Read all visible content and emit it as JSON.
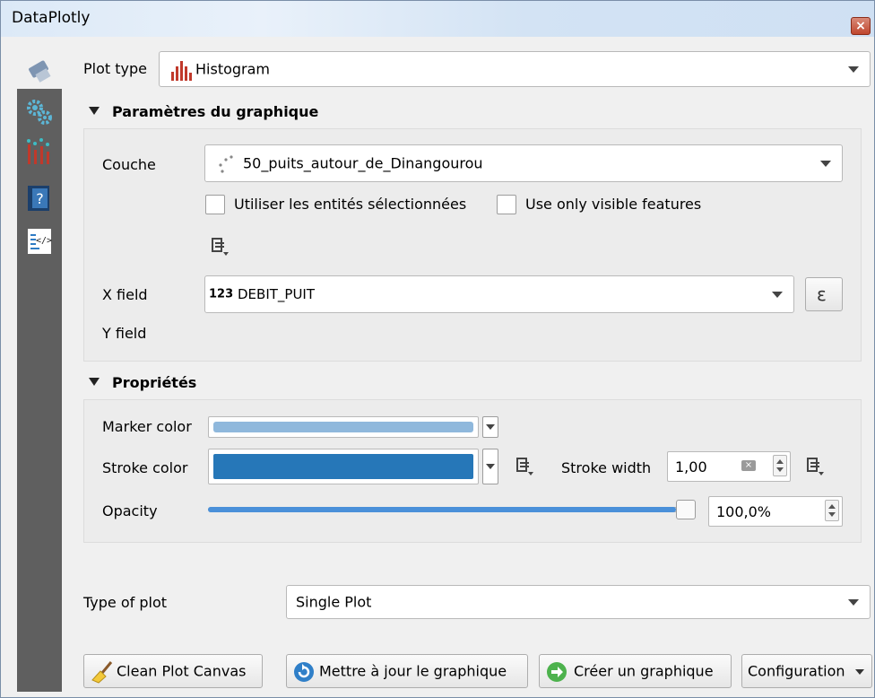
{
  "window": {
    "title": "DataPlotly",
    "close_glyph": "×"
  },
  "sidebar": {
    "icons": [
      "brush-icon",
      "settings-gears-icon",
      "plot-chart-icon",
      "help-icon",
      "code-icon"
    ]
  },
  "plot_type": {
    "label": "Plot type",
    "value": "Histogram"
  },
  "graph_params": {
    "title": "Paramètres du graphique",
    "layer_label": "Couche",
    "layer_value": "50_puits_autour_de_Dinangourou",
    "use_selected_label": "Utiliser les entités sélectionnées",
    "use_visible_label": "Use only visible features",
    "x_field_label": "X field",
    "x_field_type_badge": "123",
    "x_field_value": "DEBIT_PUIT",
    "expression_glyph": "ε",
    "y_field_label": "Y field"
  },
  "properties": {
    "title": "Propriétés",
    "marker_color_label": "Marker color",
    "stroke_color_label": "Stroke color",
    "stroke_width_label": "Stroke width",
    "stroke_width_value": "1,00",
    "opacity_label": "Opacity",
    "opacity_value": "100,0%",
    "opacity_fraction": 1.0
  },
  "colors": {
    "marker": "#8fb8dc",
    "stroke": "#2677b8",
    "slider_fill": "#4a90d9"
  },
  "type_of_plot": {
    "label": "Type of plot",
    "value": "Single Plot"
  },
  "buttons": {
    "clean": "Clean Plot Canvas",
    "update": "Mettre à jour le graphique",
    "create": "Créer un graphique",
    "config": "Configuration"
  }
}
